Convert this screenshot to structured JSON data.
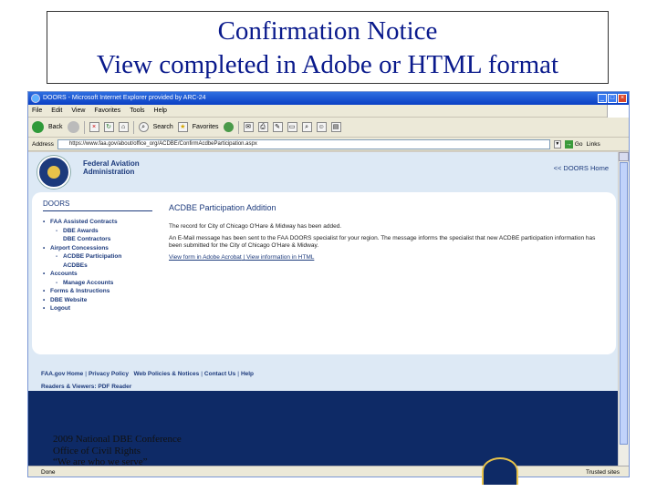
{
  "slide": {
    "title_line1": "Confirmation Notice",
    "title_line2": "View completed in Adobe or HTML format",
    "footer_line1": "2009 National DBE Conference",
    "footer_line2": "Office of Civil Rights",
    "footer_tagline": "“We are who we serve”"
  },
  "browser": {
    "window_title": "DOORS - Microsoft Internet Explorer provided by ARC-24",
    "menu": [
      "File",
      "Edit",
      "View",
      "Favorites",
      "Tools",
      "Help"
    ],
    "toolbar": {
      "back_label": "Back",
      "search_label": "Search",
      "favorites_label": "Favorites"
    },
    "address_label": "Address",
    "address_value": "https://www.faa.gov/about/office_org/ACDBE/ConfirmAcdbeParticipation.aspx",
    "go_label": "Go",
    "links_label": "Links",
    "status_text": "Done",
    "status_zone": "Trusted sites"
  },
  "page": {
    "agency_name_line1": "Federal Aviation",
    "agency_name_line2": "Administration",
    "doors_home_link": "<< DOORS Home",
    "nav_title": "DOORS",
    "nav": {
      "faa_assisted": "FAA Assisted Contracts",
      "dbe_awards": "DBE Awards",
      "dbe_contractors": "DBE Contractors",
      "airport_concessions": "Airport Concessions",
      "acdbe_participation": "ACDBE Participation",
      "acdbes": "ACDBEs",
      "accounts": "Accounts",
      "manage_accounts": "Manage Accounts",
      "forms_instructions": "Forms & Instructions",
      "dbe_website": "DBE Website",
      "logout": "Logout"
    },
    "heading": "ACDBE Participation Addition",
    "message1": "The record for City of Chicago O'Hare & Midway has been added.",
    "message2": "An E-Mail message has been sent to the FAA DOORS specialist for your region. The message informs the specialist that new ACDBE participation information has been submitted for the City of Chicago O'Hare & Midway.",
    "view_adobe_link": "View form in Adobe Acrobat",
    "view_html_link": "View information in HTML",
    "footer_row1": [
      "FAA.gov Home",
      "Privacy Policy",
      "Web Policies & Notices",
      "Contact Us",
      "Help"
    ],
    "footer_row2_label": "Readers & Viewers:",
    "footer_row2_link": "PDF Reader"
  }
}
